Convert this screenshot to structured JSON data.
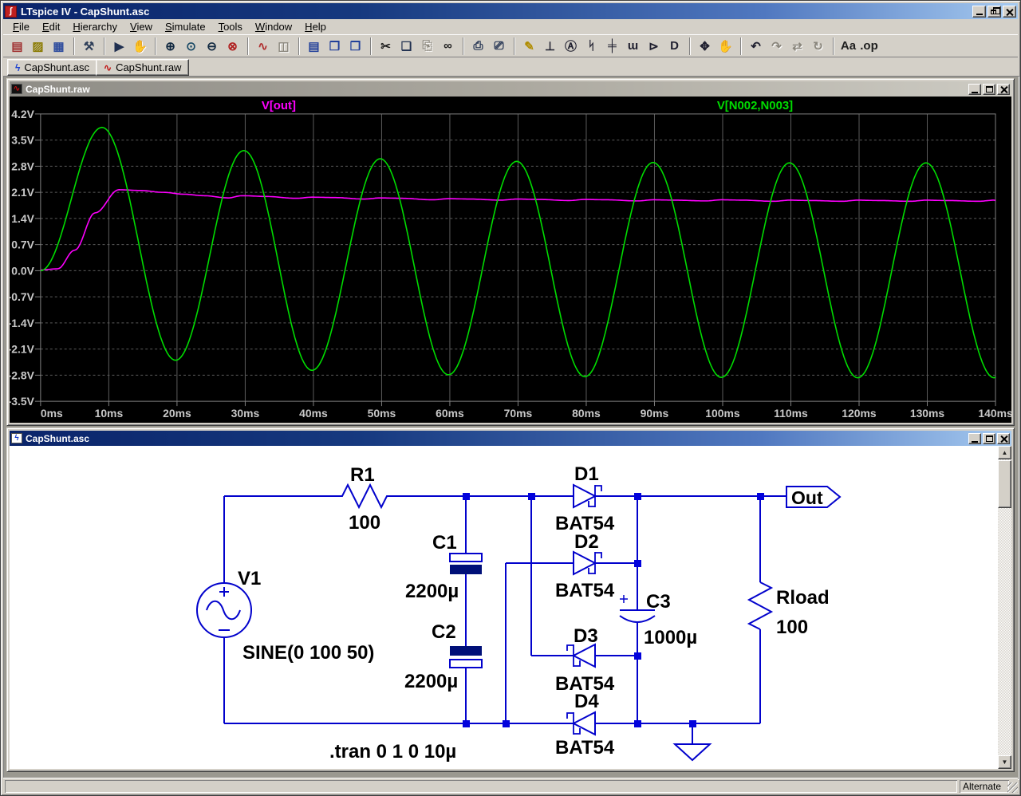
{
  "window": {
    "title": "LTspice IV - CapShunt.asc"
  },
  "menu": {
    "items": [
      "File",
      "Edit",
      "Hierarchy",
      "View",
      "Simulate",
      "Tools",
      "Window",
      "Help"
    ]
  },
  "toolbar": {
    "items": [
      {
        "name": "new-schematic",
        "glyph": "▤",
        "color": "#A03030"
      },
      {
        "name": "open-file",
        "glyph": "▨",
        "color": "#8A7A00"
      },
      {
        "name": "save",
        "glyph": "▦",
        "color": "#2F4D9E"
      },
      {
        "name": "control-panel",
        "glyph": "⚒",
        "color": "#30405A",
        "sep": true
      },
      {
        "name": "run",
        "glyph": "▶",
        "color": "#203050",
        "sep": true
      },
      {
        "name": "halt",
        "glyph": "✋",
        "color": "#888",
        "disabled": true
      },
      {
        "name": "zoom-in",
        "glyph": "⊕",
        "color": "#102840",
        "sep": true
      },
      {
        "name": "zoom-area",
        "glyph": "⊙",
        "color": "#1A4A66"
      },
      {
        "name": "zoom-out",
        "glyph": "⊖",
        "color": "#102840"
      },
      {
        "name": "zoom-full-extents",
        "glyph": "⊗",
        "color": "#B02020"
      },
      {
        "name": "autorange-y-axis",
        "glyph": "∿",
        "color": "#B03030",
        "sep": true
      },
      {
        "name": "pan",
        "glyph": "◫",
        "color": "#888",
        "disabled": true
      },
      {
        "name": "tile-horizontally",
        "glyph": "▤",
        "color": "#22409A",
        "sep": true
      },
      {
        "name": "tile-vertically",
        "glyph": "❐",
        "color": "#22409A"
      },
      {
        "name": "cascade-windows",
        "glyph": "❒",
        "color": "#22409A"
      },
      {
        "name": "cut",
        "glyph": "✂",
        "color": "#202020",
        "sep": true
      },
      {
        "name": "copy",
        "glyph": "❏",
        "color": "#203050"
      },
      {
        "name": "paste",
        "glyph": "⎘",
        "color": "#888",
        "disabled": true
      },
      {
        "name": "find",
        "glyph": "∞",
        "color": "#202020"
      },
      {
        "name": "print",
        "glyph": "⎙",
        "color": "#203050",
        "sep": true
      },
      {
        "name": "print-preview",
        "glyph": "⎚",
        "color": "#203050"
      },
      {
        "name": "draw-wire",
        "glyph": "✎",
        "color": "#B08C00",
        "sep": true
      },
      {
        "name": "place-ground",
        "glyph": "⊥",
        "color": "#202030"
      },
      {
        "name": "label-net",
        "glyph": "Ⓐ",
        "color": "#202030"
      },
      {
        "name": "place-resistor",
        "glyph": "ᛋ",
        "color": "#202030"
      },
      {
        "name": "place-capacitor",
        "glyph": "╪",
        "color": "#202030"
      },
      {
        "name": "place-inductor",
        "glyph": "ɯ",
        "color": "#202030"
      },
      {
        "name": "place-diode",
        "glyph": "⊳",
        "color": "#202030"
      },
      {
        "name": "place-component",
        "glyph": "D",
        "color": "#202030"
      },
      {
        "name": "move",
        "glyph": "✥",
        "color": "#202030",
        "sep": true
      },
      {
        "name": "drag",
        "glyph": "✋",
        "color": "#202030"
      },
      {
        "name": "undo",
        "glyph": "↶",
        "color": "#202030",
        "sep": true
      },
      {
        "name": "redo",
        "glyph": "↷",
        "color": "#888",
        "disabled": true
      },
      {
        "name": "mirror",
        "glyph": "⇄",
        "color": "#888",
        "disabled": true
      },
      {
        "name": "rotate",
        "glyph": "↻",
        "color": "#888",
        "disabled": true
      },
      {
        "name": "add-text",
        "glyph": "Aa",
        "color": "#202020",
        "sep": true
      },
      {
        "name": "spice-directive",
        "glyph": ".op",
        "color": "#202020"
      }
    ]
  },
  "tabs": [
    {
      "label": "CapShunt.asc",
      "icon_glyph": "ϟ",
      "icon_color": "#1A3FD0"
    },
    {
      "label": "CapShunt.raw",
      "icon_glyph": "∿",
      "icon_color": "#C01010"
    }
  ],
  "plot_window": {
    "title": "CapShunt.raw",
    "active": false
  },
  "schematic_window": {
    "title": "CapShunt.asc",
    "active": true
  },
  "chart_data": {
    "type": "line",
    "title": "",
    "x_unit": "ms",
    "x_range_ms": [
      0,
      140
    ],
    "y_range_V": [
      -3.5,
      4.2
    ],
    "x_tick_values_ms": [
      0,
      10,
      20,
      30,
      40,
      50,
      60,
      70,
      80,
      90,
      100,
      110,
      120,
      130,
      140
    ],
    "x_tick_labels": [
      "0ms",
      "10ms",
      "20ms",
      "30ms",
      "40ms",
      "50ms",
      "60ms",
      "70ms",
      "80ms",
      "90ms",
      "100ms",
      "110ms",
      "120ms",
      "130ms",
      "140ms"
    ],
    "y_tick_values_V": [
      4.2,
      3.5,
      2.8,
      2.1,
      1.4,
      0.7,
      0.0,
      -0.7,
      -1.4,
      -2.1,
      -2.8,
      -3.5
    ],
    "y_tick_labels": [
      "4.2V",
      "3.5V",
      "2.8V",
      "2.1V",
      "1.4V",
      "0.7V",
      "0.0V",
      "-0.7V",
      "-1.4V",
      "-2.1V",
      "-2.8V",
      "-3.5V"
    ],
    "grid": {
      "vertical_lines": "solid",
      "horizontal_lines": "dashed",
      "color": "#5C5C5C"
    },
    "legend_position": "top",
    "series": [
      {
        "name": "V(out)",
        "label": "V[out]",
        "color": "#FF00FF",
        "keypoints_t_ms_v": [
          [
            0,
            0.02
          ],
          [
            2.5,
            0.05
          ],
          [
            5,
            0.55
          ],
          [
            8,
            1.55
          ],
          [
            11.5,
            2.17
          ],
          [
            14.5,
            2.15
          ],
          [
            18,
            2.1
          ],
          [
            21,
            2.05
          ],
          [
            24,
            2.01
          ],
          [
            27.5,
            1.95
          ],
          [
            29.5,
            2.01
          ],
          [
            33,
            1.99
          ],
          [
            37.5,
            1.94
          ],
          [
            39.8,
            1.97
          ],
          [
            43,
            1.96
          ],
          [
            47.5,
            1.92
          ],
          [
            49.8,
            1.95
          ],
          [
            53,
            1.94
          ],
          [
            57.5,
            1.9
          ],
          [
            59.8,
            1.93
          ],
          [
            63,
            1.92
          ],
          [
            67.5,
            1.89
          ],
          [
            69.8,
            1.92
          ],
          [
            73,
            1.91
          ],
          [
            77.5,
            1.88
          ],
          [
            79.8,
            1.91
          ],
          [
            83,
            1.9
          ],
          [
            87.5,
            1.87
          ],
          [
            89.8,
            1.9
          ],
          [
            93,
            1.89
          ],
          [
            97.5,
            1.87
          ],
          [
            99.8,
            1.9
          ],
          [
            103,
            1.89
          ],
          [
            107.5,
            1.86
          ],
          [
            109.8,
            1.89
          ],
          [
            113,
            1.88
          ],
          [
            117.5,
            1.86
          ],
          [
            119.8,
            1.89
          ],
          [
            123,
            1.88
          ],
          [
            127.5,
            1.86
          ],
          [
            129.8,
            1.89
          ],
          [
            133,
            1.88
          ],
          [
            137.5,
            1.86
          ],
          [
            139.8,
            1.89
          ],
          [
            140,
            1.88
          ]
        ]
      },
      {
        "name": "V(N002,N003)",
        "label": "V[N002,N003]",
        "color": "#00DC00",
        "keypoints_t_ms_v": [
          [
            0,
            0
          ],
          [
            9,
            3.84
          ],
          [
            19.8,
            -2.4
          ],
          [
            29.8,
            3.22
          ],
          [
            39.8,
            -2.67
          ],
          [
            49.8,
            3.0
          ],
          [
            59.8,
            -2.79
          ],
          [
            69.8,
            2.93
          ],
          [
            79.8,
            -2.84
          ],
          [
            89.8,
            2.9
          ],
          [
            99.8,
            -2.86
          ],
          [
            109.8,
            2.89
          ],
          [
            119.8,
            -2.87
          ],
          [
            129.8,
            2.89
          ],
          [
            139.8,
            -2.87
          ],
          [
            140,
            -2.85
          ]
        ]
      }
    ]
  },
  "schematic": {
    "components": {
      "v1": {
        "name": "V1",
        "value": "SINE(0 100 50)"
      },
      "r1": {
        "name": "R1",
        "value": "100"
      },
      "c1": {
        "name": "C1",
        "value": "2200µ"
      },
      "c2": {
        "name": "C2",
        "value": "2200µ"
      },
      "c3": {
        "name": "C3",
        "value": "1000µ",
        "polarity_mark": "+"
      },
      "d1": {
        "name": "D1",
        "value": "BAT54"
      },
      "d2": {
        "name": "D2",
        "value": "BAT54"
      },
      "d3": {
        "name": "D3",
        "value": "BAT54"
      },
      "d4": {
        "name": "D4",
        "value": "BAT54"
      },
      "rload": {
        "name": "Rload",
        "value": "100"
      }
    },
    "net_label": "Out",
    "directive": ".tran 0 1 0 10µ",
    "wire_color": "#0202CC",
    "text_color": "#000000"
  },
  "statusbar": {
    "mode": "Alternate"
  }
}
